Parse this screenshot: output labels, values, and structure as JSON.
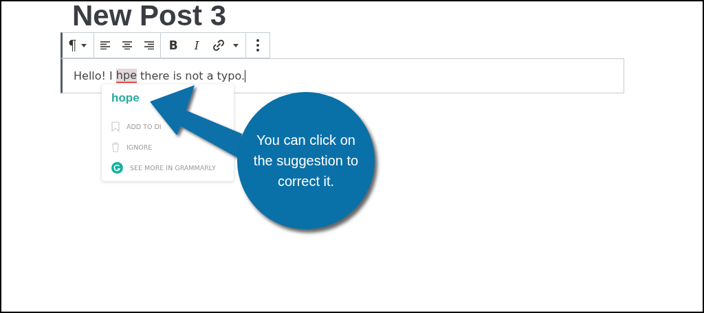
{
  "post_title": "New Post 3",
  "toolbar": {
    "items": [
      {
        "kind": "paragraph",
        "label": "¶"
      },
      {
        "kind": "caret"
      },
      {
        "kind": "align-left"
      },
      {
        "kind": "align-center"
      },
      {
        "kind": "align-right"
      },
      {
        "kind": "bold",
        "label": "B"
      },
      {
        "kind": "italic",
        "label": "I"
      },
      {
        "kind": "link"
      },
      {
        "kind": "caret"
      },
      {
        "kind": "more"
      }
    ]
  },
  "paragraph": {
    "before": "Hello! I ",
    "misspelled": "hpe",
    "after": " there is not a typo."
  },
  "suggestion_popup": {
    "suggestion": "hope",
    "actions": [
      {
        "kind": "bookmark",
        "label": "ADD TO DI"
      },
      {
        "kind": "trash",
        "label": "IGNORE"
      },
      {
        "kind": "grammarly",
        "label": "SEE MORE IN GRAMMARLY"
      }
    ]
  },
  "callout": {
    "text": "You can click on the suggestion to correct it."
  }
}
